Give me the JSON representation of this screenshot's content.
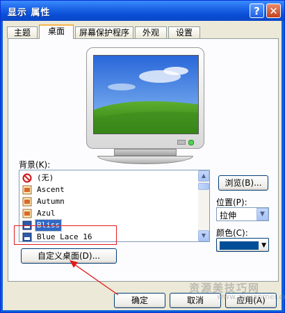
{
  "window": {
    "title": "显示 属性",
    "help_button": "?",
    "close_button": "✕"
  },
  "tabs": [
    {
      "label": "主题",
      "active": false
    },
    {
      "label": "桌面",
      "active": true
    },
    {
      "label": "屏幕保护程序",
      "active": false
    },
    {
      "label": "外观",
      "active": false
    },
    {
      "label": "设置",
      "active": false
    }
  ],
  "desktop": {
    "background_label": "背景(K):",
    "background_items": [
      {
        "label": "(无)",
        "icon": "none-icon"
      },
      {
        "label": "Ascent",
        "icon": "image-file-icon"
      },
      {
        "label": "Autumn",
        "icon": "image-file-icon"
      },
      {
        "label": "Azul",
        "icon": "image-file-icon"
      },
      {
        "label": "Bliss",
        "icon": "bitmap-file-icon",
        "selected": true
      },
      {
        "label": "Blue Lace 16",
        "icon": "bitmap-file-icon"
      }
    ],
    "browse_button": "浏览(B)...",
    "position_label": "位置(P):",
    "position_value": "拉伸",
    "color_label": "颜色(C):",
    "color_value": "#004e98",
    "customize_button": "自定义桌面(D)..."
  },
  "footer": {
    "ok_button": "确定",
    "cancel_button": "取消",
    "apply_button": "应用(A)"
  },
  "watermark": {
    "line1": "资源美技巧网",
    "line2": "www.ziyuanmei.com"
  },
  "colors": {
    "title_bar": "#0a4ed6",
    "dialog_bg": "#ece9d8",
    "selection": "#316ac5",
    "annotation": "#e21b1b"
  }
}
